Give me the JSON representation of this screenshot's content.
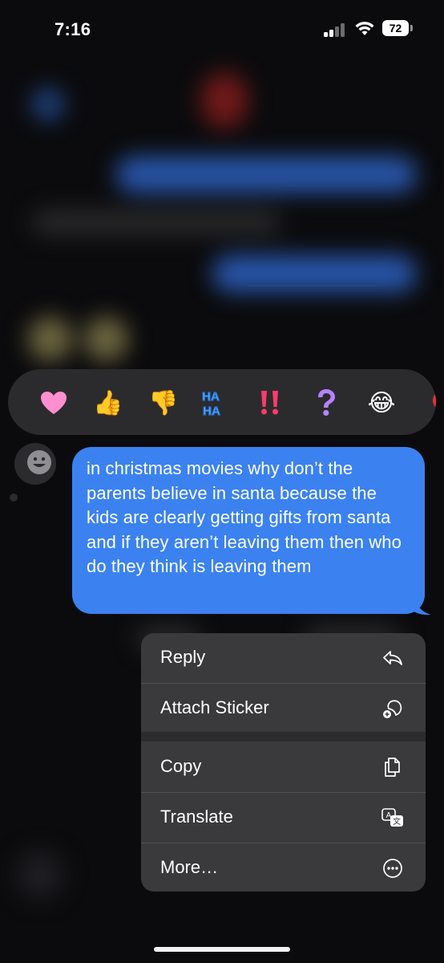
{
  "status_bar": {
    "time": "7:16",
    "battery": "72"
  },
  "reactions": [
    {
      "name": "heart",
      "glyph": "🩷"
    },
    {
      "name": "thumbs-up",
      "glyph": "👍"
    },
    {
      "name": "thumbs-down",
      "glyph": "👎"
    },
    {
      "name": "haha",
      "glyph": "HA HA"
    },
    {
      "name": "exclamation",
      "glyph": "‼️"
    },
    {
      "name": "question",
      "glyph": "❓"
    },
    {
      "name": "laughing",
      "glyph": "😂"
    }
  ],
  "message": {
    "text": "in christmas movies why don’t the parents believe in santa because the kids are clearly getting gifts from santa and if they aren’t leaving them then who do they think is leaving them",
    "bubble_color": "#3b82f0"
  },
  "context_menu": {
    "reply": "Reply",
    "attach_sticker": "Attach Sticker",
    "copy": "Copy",
    "translate": "Translate",
    "more": "More…"
  },
  "icons": {
    "reply": "reply-arrow-icon",
    "sticker": "sticker-add-icon",
    "copy": "document-copy-icon",
    "translate": "translate-icon",
    "more": "ellipsis-circle-icon"
  },
  "colors": {
    "menu_background": "#3a3a3c",
    "reaction_bar": "#2b2b2e"
  }
}
